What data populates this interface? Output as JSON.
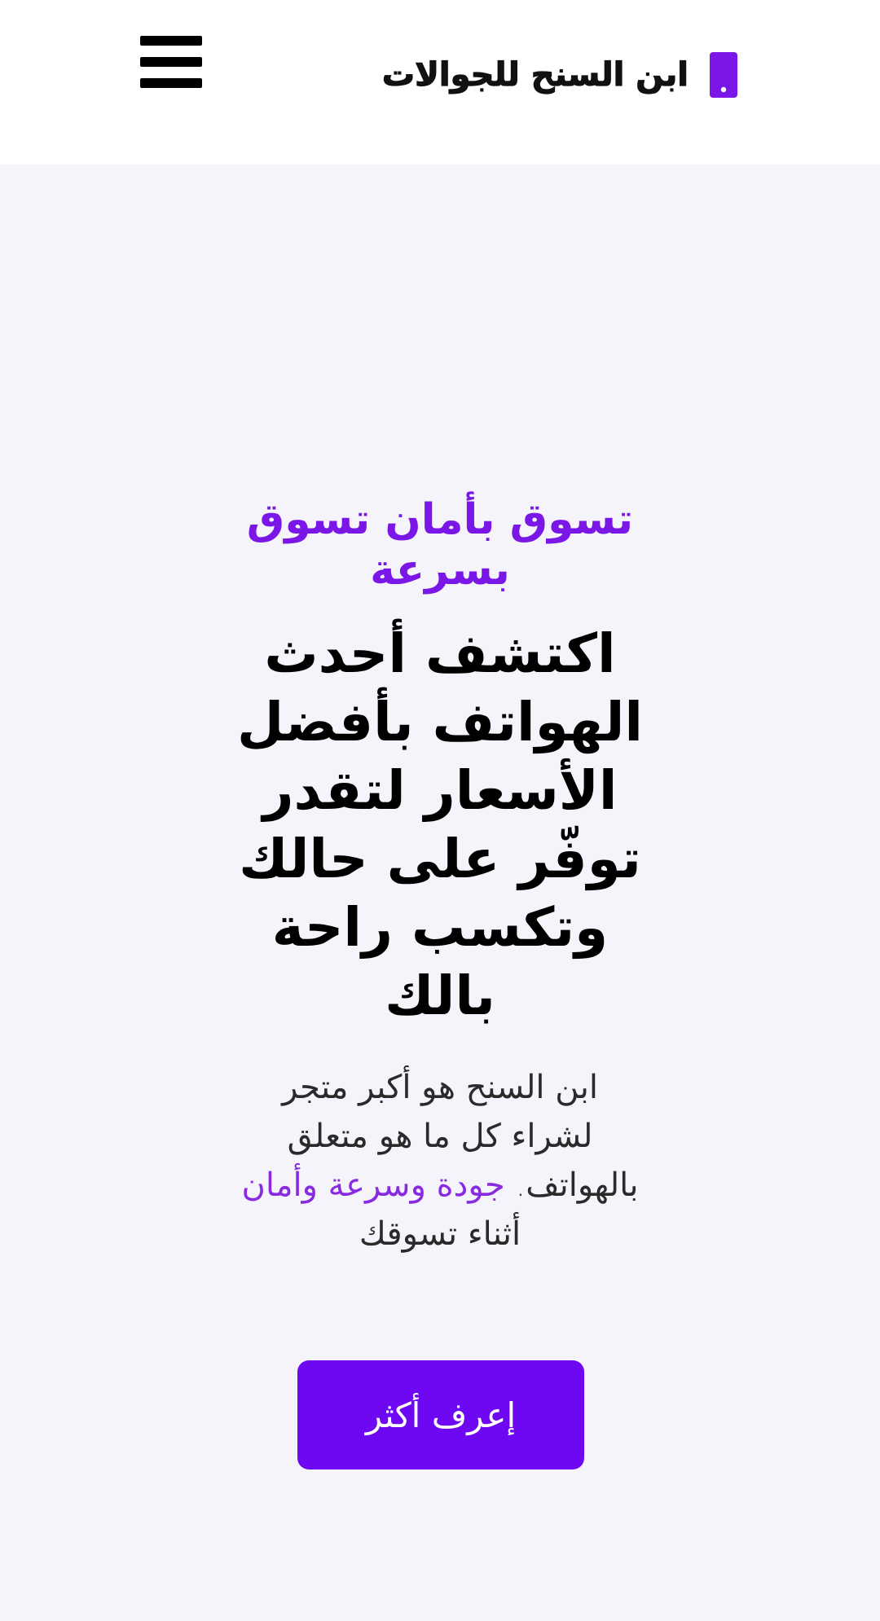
{
  "header": {
    "brand_name": "ابن السنح للجوالات",
    "brand_icon": "phone-icon",
    "menu_icon": "hamburger-menu-icon"
  },
  "hero": {
    "tagline": "تسوق بأمان تسوق بسرعة",
    "headline": "اكتشف أحدث الهواتف بأفضل الأسعار لتقدر توفّر على حالك وتكسب راحة بالك",
    "description_start": "ابن السنح هو أكبر متجر لشراء كل ما هو متعلق بالهواتف.",
    "description_highlight": "جودة وسرعة وأمان",
    "description_end": "أثناء تسوقك",
    "cta_label": "إعرف أكثر"
  },
  "colors": {
    "accent": "#6f08f2",
    "tagline": "#7a17e6",
    "background": "#f5f4fa",
    "header_background": "#ffffff"
  }
}
